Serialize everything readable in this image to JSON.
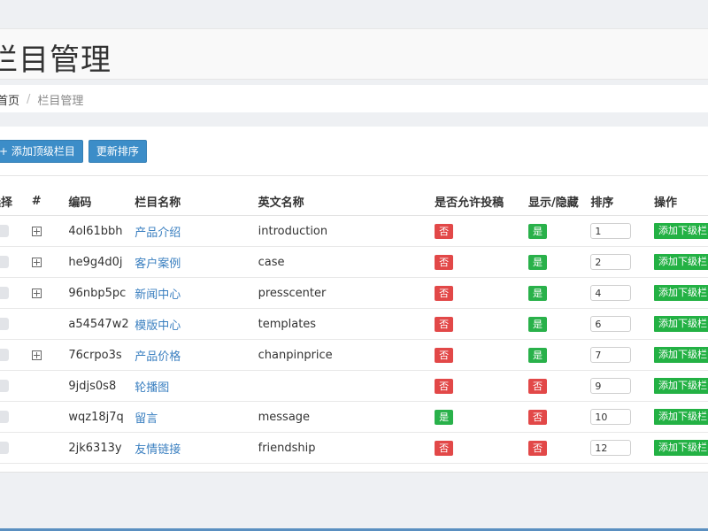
{
  "page": {
    "title": "栏目管理"
  },
  "breadcrumb": {
    "home": "首页",
    "separator": "/",
    "current": "栏目管理"
  },
  "toolbar": {
    "add_top_label": "+ 添加顶级栏目",
    "update_sort_label": "更新排序"
  },
  "table": {
    "headers": {
      "select": "选择",
      "expand": "#",
      "code": "编码",
      "name": "栏目名称",
      "english": "英文名称",
      "allow_post": "是否允许投稿",
      "show_hide": "显示/隐藏",
      "sort": "排序",
      "action": "操作"
    },
    "action_label": "添加下级栏目",
    "rows": [
      {
        "expandable": true,
        "code": "4ol61bbh",
        "name": "产品介绍",
        "english": "introduction",
        "allow_post": "否",
        "show": "是",
        "sort": "1"
      },
      {
        "expandable": true,
        "code": "he9g4d0j",
        "name": "客户案例",
        "english": "case",
        "allow_post": "否",
        "show": "是",
        "sort": "2"
      },
      {
        "expandable": true,
        "code": "96nbp5pc",
        "name": "新闻中心",
        "english": "presscenter",
        "allow_post": "否",
        "show": "是",
        "sort": "4"
      },
      {
        "expandable": false,
        "code": "a54547w2",
        "name": "模版中心",
        "english": "templates",
        "allow_post": "否",
        "show": "是",
        "sort": "6"
      },
      {
        "expandable": true,
        "code": "76crpo3s",
        "name": "产品价格",
        "english": "chanpinprice",
        "allow_post": "否",
        "show": "是",
        "sort": "7"
      },
      {
        "expandable": false,
        "code": "9jdjs0s8",
        "name": "轮播图",
        "english": "",
        "allow_post": "否",
        "show": "否",
        "sort": "9"
      },
      {
        "expandable": false,
        "code": "wqz18j7q",
        "name": "留言",
        "english": "message",
        "allow_post": "是",
        "show": "否",
        "sort": "10"
      },
      {
        "expandable": false,
        "code": "2jk6313y",
        "name": "友情链接",
        "english": "friendship",
        "allow_post": "否",
        "show": "否",
        "sort": "12"
      }
    ]
  },
  "colors": {
    "primary": "#3c8dc8",
    "yes": "#29b14a",
    "no": "#e24848",
    "link": "#3a7fc0"
  }
}
